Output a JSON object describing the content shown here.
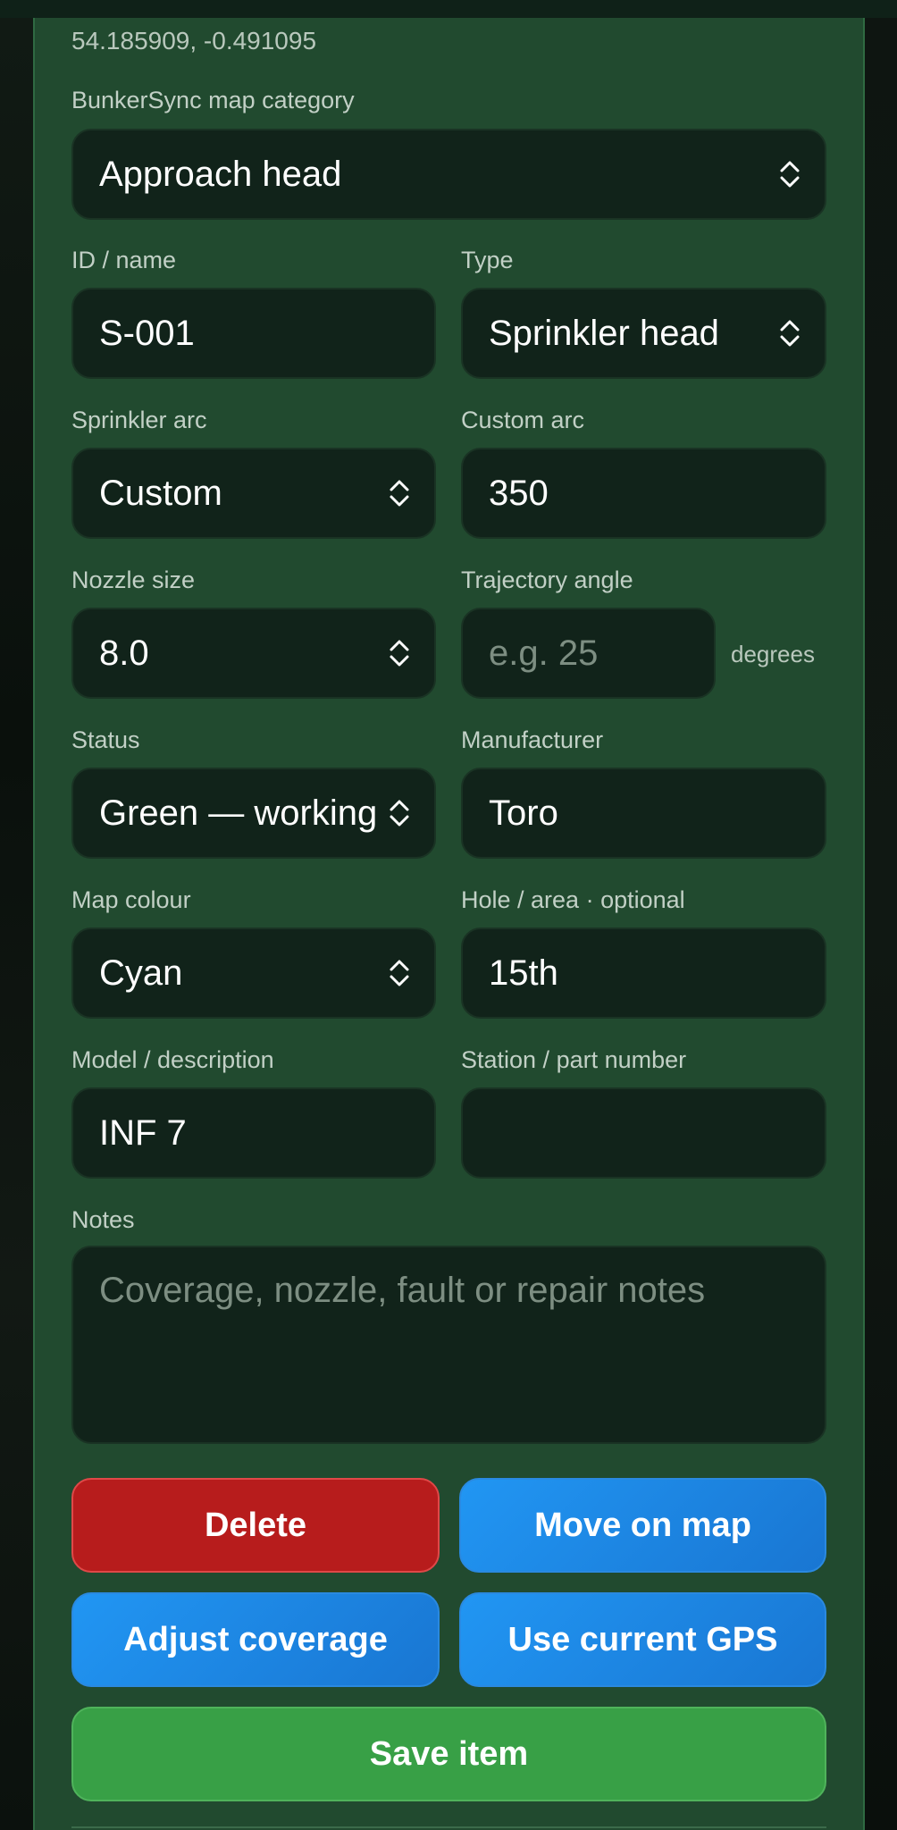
{
  "location": {
    "coordinates": "54.185909, -0.491095"
  },
  "category": {
    "label": "BunkerSync map category",
    "value": "Approach head"
  },
  "id_name": {
    "label": "ID / name",
    "value": "S-001"
  },
  "type": {
    "label": "Type",
    "value": "Sprinkler head"
  },
  "sprinkler_arc": {
    "label": "Sprinkler arc",
    "value": "Custom"
  },
  "custom_arc": {
    "label": "Custom arc",
    "value": "350"
  },
  "nozzle_size": {
    "label": "Nozzle size",
    "value": "8.0"
  },
  "trajectory_angle": {
    "label": "Trajectory angle",
    "placeholder": "e.g. 25",
    "unit": "degrees"
  },
  "status": {
    "label": "Status",
    "value": "Green — working"
  },
  "manufacturer": {
    "label": "Manufacturer",
    "value": "Toro"
  },
  "map_colour": {
    "label": "Map colour",
    "value": "Cyan"
  },
  "hole_area": {
    "label": "Hole / area · optional",
    "value": "15th"
  },
  "model": {
    "label": "Model / description",
    "value": "INF 7"
  },
  "station": {
    "label": "Station / part number",
    "value": ""
  },
  "notes": {
    "label": "Notes",
    "placeholder": "Coverage, nozzle, fault or repair notes"
  },
  "buttons": {
    "delete": "Delete",
    "move": "Move on map",
    "adjust": "Adjust coverage",
    "gps": "Use current GPS",
    "save": "Save item"
  },
  "colors": {
    "panel": "#214a2f",
    "field": "#11231a",
    "delete": "#b71c1c",
    "blue": "#1e88e5",
    "save": "#38a046"
  }
}
